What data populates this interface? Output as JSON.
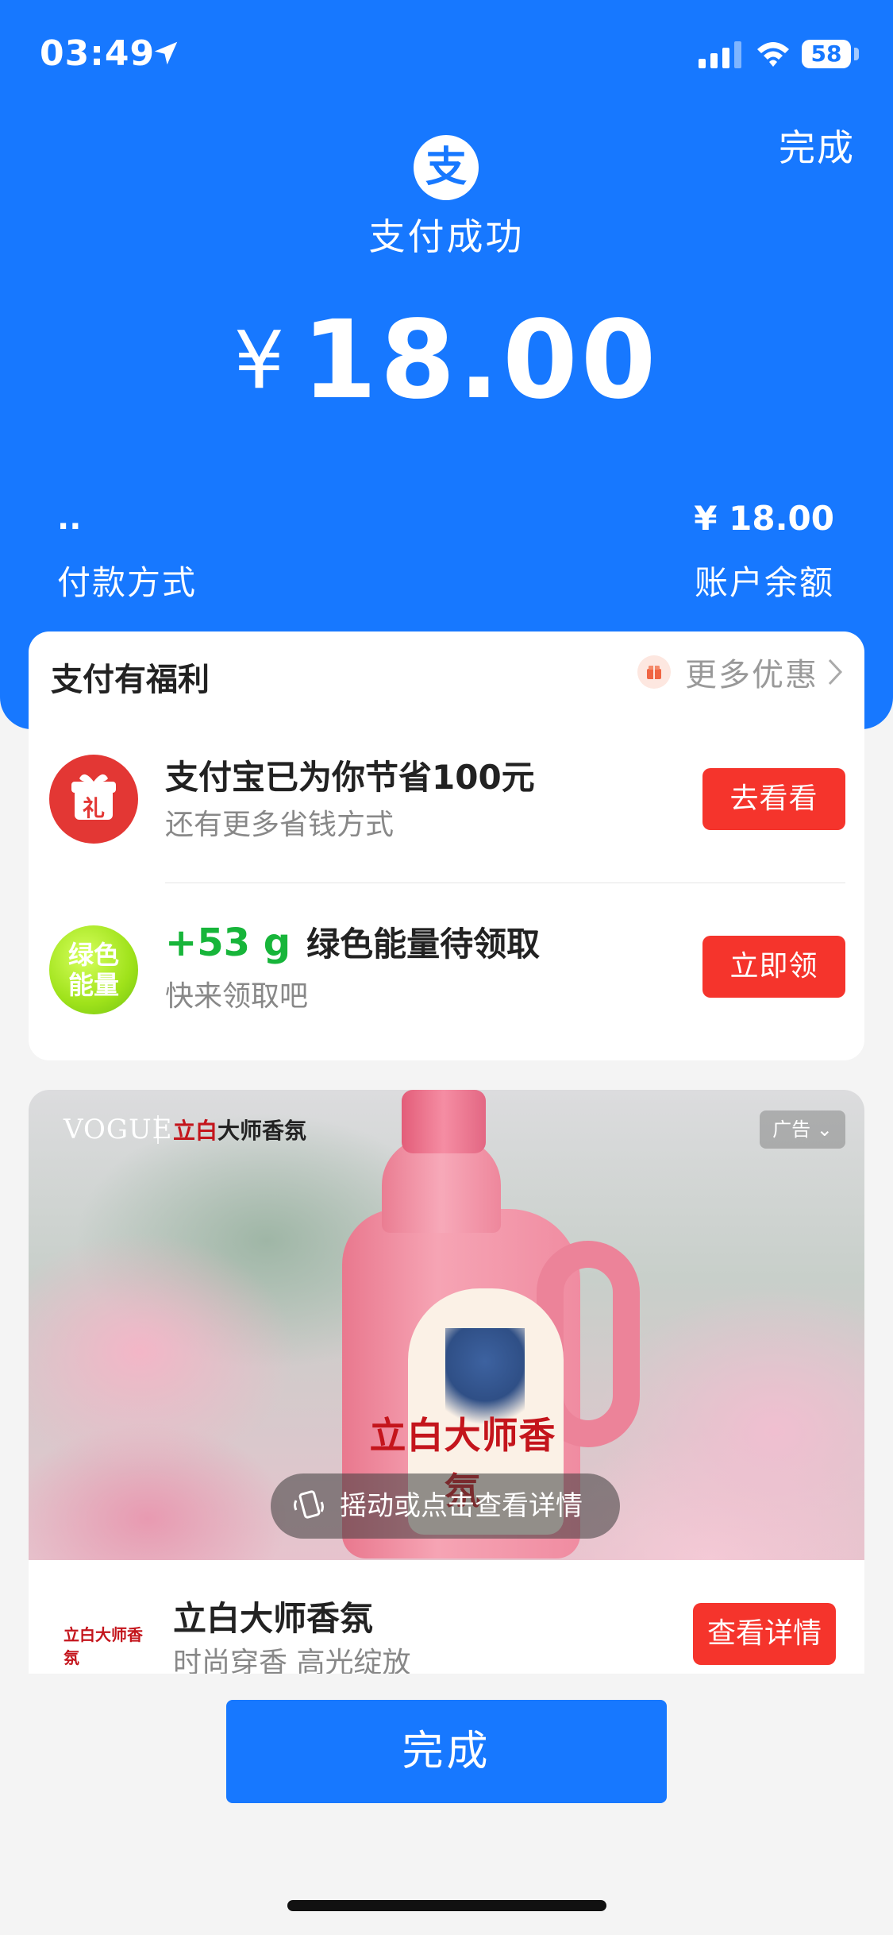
{
  "status_bar": {
    "time": "03:49",
    "battery": "58"
  },
  "header": {
    "done_label": "完成",
    "logo_glyph": "支",
    "status_title": "支付成功",
    "currency_symbol": "¥",
    "amount": "18.00"
  },
  "payment_info": {
    "method_value": "..",
    "method_label": "付款方式",
    "balance_value": "¥ 18.00",
    "balance_label": "账户余额"
  },
  "benefits": {
    "title": "支付有福利",
    "more_label": "更多优惠",
    "items": [
      {
        "icon_glyph": "礼",
        "title": "支付宝已为你节省100元",
        "subtitle": "还有更多省钱方式",
        "button": "去看看"
      },
      {
        "icon_line1": "绿色",
        "icon_line2": "能量",
        "highlight": "+53 g",
        "title": "绿色能量待领取",
        "subtitle": "快来领取吧",
        "button": "立即领"
      }
    ]
  },
  "ad": {
    "vogue": "VOGUE",
    "brand_top_red": "立白",
    "brand_top_rest": "大师香氛",
    "tag": "广告",
    "bottle_brand": "立白大师香氛",
    "shake_text": "摇动或点击查看详情",
    "logo_text": "立白大师香氛",
    "title": "立白大师香氛",
    "subtitle": "时尚穿香 高光绽放",
    "button": "查看详情"
  },
  "footer": {
    "done_label": "完成"
  },
  "colors": {
    "primary": "#1778ff",
    "cta_red": "#f5342c",
    "energy_green": "#17b53a"
  }
}
